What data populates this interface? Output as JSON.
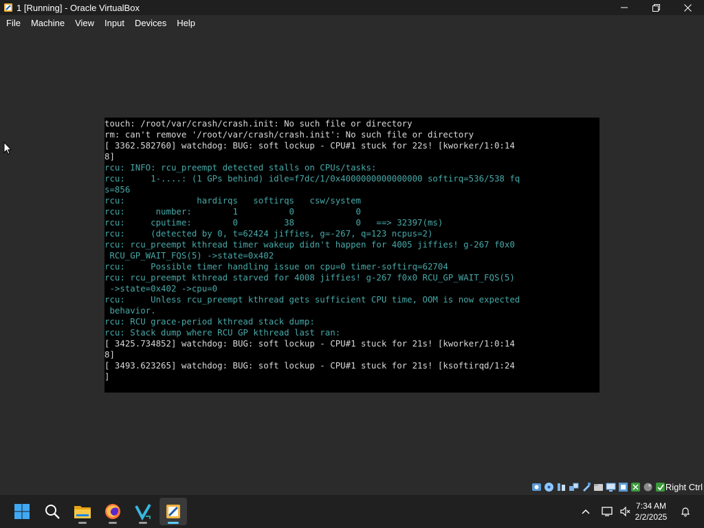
{
  "window": {
    "title": "1 [Running] - Oracle VirtualBox"
  },
  "menu": [
    "File",
    "Machine",
    "View",
    "Input",
    "Devices",
    "Help"
  ],
  "console": {
    "lines": [
      {
        "text": "touch: /root/var/crash/crash.init: No such file or directory",
        "color": "#d9d9d9"
      },
      {
        "text": "rm: can't remove '/root/var/crash/crash.init': No such file or directory",
        "color": "#d9d9d9"
      },
      {
        "text": "[ 3362.582760] watchdog: BUG: soft lockup - CPU#1 stuck for 22s! [kworker/1:0:14",
        "color": "#d9d9d9"
      },
      {
        "text": "8]",
        "color": "#d9d9d9"
      },
      {
        "text": "rcu: INFO: rcu_preempt detected stalls on CPUs/tasks:",
        "color": "#48a8a8"
      },
      {
        "text": "rcu:     1-....: (1 GPs behind) idle=f7dc/1/0x4000000000000000 softirq=536/538 fq",
        "color": "#48a8a8"
      },
      {
        "text": "s=856",
        "color": "#48a8a8"
      },
      {
        "text": "rcu:              hardirqs   softirqs   csw/system",
        "color": "#48a8a8"
      },
      {
        "text": "rcu:      number:        1          0            0",
        "color": "#48a8a8"
      },
      {
        "text": "rcu:     cputime:        0         38            0   ==> 32397(ms)",
        "color": "#48a8a8"
      },
      {
        "text": "rcu:     (detected by 0, t=62424 jiffies, g=-267, q=123 ncpus=2)",
        "color": "#48a8a8"
      },
      {
        "text": "rcu: rcu_preempt kthread timer wakeup didn't happen for 4005 jiffies! g-267 f0x0",
        "color": "#48a8a8"
      },
      {
        "text": " RCU_GP_WAIT_FQS(5) ->state=0x402",
        "color": "#48a8a8"
      },
      {
        "text": "rcu:     Possible timer handling issue on cpu=0 timer-softirq=62704",
        "color": "#48a8a8"
      },
      {
        "text": "rcu: rcu_preempt kthread starved for 4008 jiffies! g-267 f0x0 RCU_GP_WAIT_FQS(5)",
        "color": "#48a8a8"
      },
      {
        "text": " ->state=0x402 ->cpu=0",
        "color": "#48a8a8"
      },
      {
        "text": "rcu:     Unless rcu_preempt kthread gets sufficient CPU time, OOM is now expected",
        "color": "#48a8a8"
      },
      {
        "text": " behavior.",
        "color": "#48a8a8"
      },
      {
        "text": "rcu: RCU grace-period kthread stack dump:",
        "color": "#48a8a8"
      },
      {
        "text": "rcu: Stack dump where RCU GP kthread last ran:",
        "color": "#48a8a8"
      },
      {
        "text": "[ 3425.734852] watchdog: BUG: soft lockup - CPU#1 stuck for 21s! [kworker/1:0:14",
        "color": "#d9d9d9"
      },
      {
        "text": "8]",
        "color": "#d9d9d9"
      },
      {
        "text": "[ 3493.623265] watchdog: BUG: soft lockup - CPU#1 stuck for 21s! [ksoftirqd/1:24",
        "color": "#d9d9d9"
      },
      {
        "text": "]",
        "color": "#d9d9d9"
      }
    ]
  },
  "statusbar": {
    "host_key": "Right Ctrl",
    "icons": [
      "hard-disk-icon",
      "optical-drive-icon",
      "audio-icon",
      "network-icon",
      "usb-icon",
      "shared-folders-icon",
      "display-icon",
      "recording-icon",
      "cpu-icon",
      "mouse-integration-icon",
      "keyboard-icon"
    ]
  },
  "taskbar": {
    "apps": [
      "start-icon",
      "search-icon",
      "file-explorer-icon",
      "firefox-icon",
      "vscode-icon",
      "virtualbox-icon"
    ],
    "time": "7:34 AM",
    "date": "2/2/2025"
  }
}
